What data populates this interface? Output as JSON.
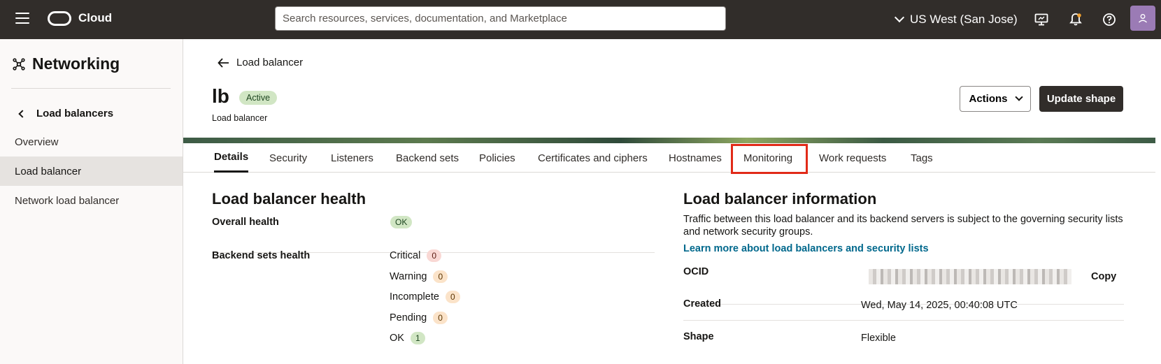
{
  "topbar": {
    "brand": "Cloud",
    "search_placeholder": "Search resources, services, documentation, and Marketplace",
    "region": "US West (San Jose)",
    "icons": [
      "menu-icon",
      "monitor-icon",
      "bell-icon",
      "help-icon",
      "user-icon"
    ],
    "avatar_color": "#9b7bb5"
  },
  "sidebar": {
    "title": "Networking",
    "back_label": "Load balancers",
    "items": [
      {
        "label": "Overview",
        "active": false
      },
      {
        "label": "Load balancer",
        "active": true
      },
      {
        "label": "Network load balancer",
        "active": false
      }
    ]
  },
  "header": {
    "breadcrumb": "Load balancer",
    "title": "lb",
    "status": "Active",
    "subtitle": "Load balancer",
    "actions_label": "Actions",
    "update_label": "Update shape"
  },
  "tabs": [
    {
      "label": "Details",
      "active": true
    },
    {
      "label": "Security"
    },
    {
      "label": "Listeners"
    },
    {
      "label": "Backend sets"
    },
    {
      "label": "Policies"
    },
    {
      "label": "Certificates and ciphers"
    },
    {
      "label": "Hostnames"
    },
    {
      "label": "Monitoring",
      "highlighted": true
    },
    {
      "label": "Work requests"
    },
    {
      "label": "Tags"
    }
  ],
  "health": {
    "title": "Load balancer health",
    "overall_label": "Overall health",
    "overall_value": "OK",
    "backend_label": "Backend sets health",
    "rows": [
      {
        "label": "Critical",
        "count": "0"
      },
      {
        "label": "Warning",
        "count": "0"
      },
      {
        "label": "Incomplete",
        "count": "0"
      },
      {
        "label": "Pending",
        "count": "0"
      },
      {
        "label": "OK",
        "count": "1"
      }
    ]
  },
  "info": {
    "title": "Load balancer information",
    "description": "Traffic between this load balancer and its backend servers is subject to the governing security lists and network security groups.",
    "link": "Learn more about load balancers and security lists",
    "ocid_label": "OCID",
    "copy_label": "Copy",
    "created_label": "Created",
    "created_value": "Wed, May 14, 2025, 00:40:08 UTC",
    "shape_label": "Shape",
    "shape_value": "Flexible"
  },
  "colors": {
    "topbar": "#312d2a",
    "accent_link": "#00688c",
    "highlight": "#e12a18"
  }
}
